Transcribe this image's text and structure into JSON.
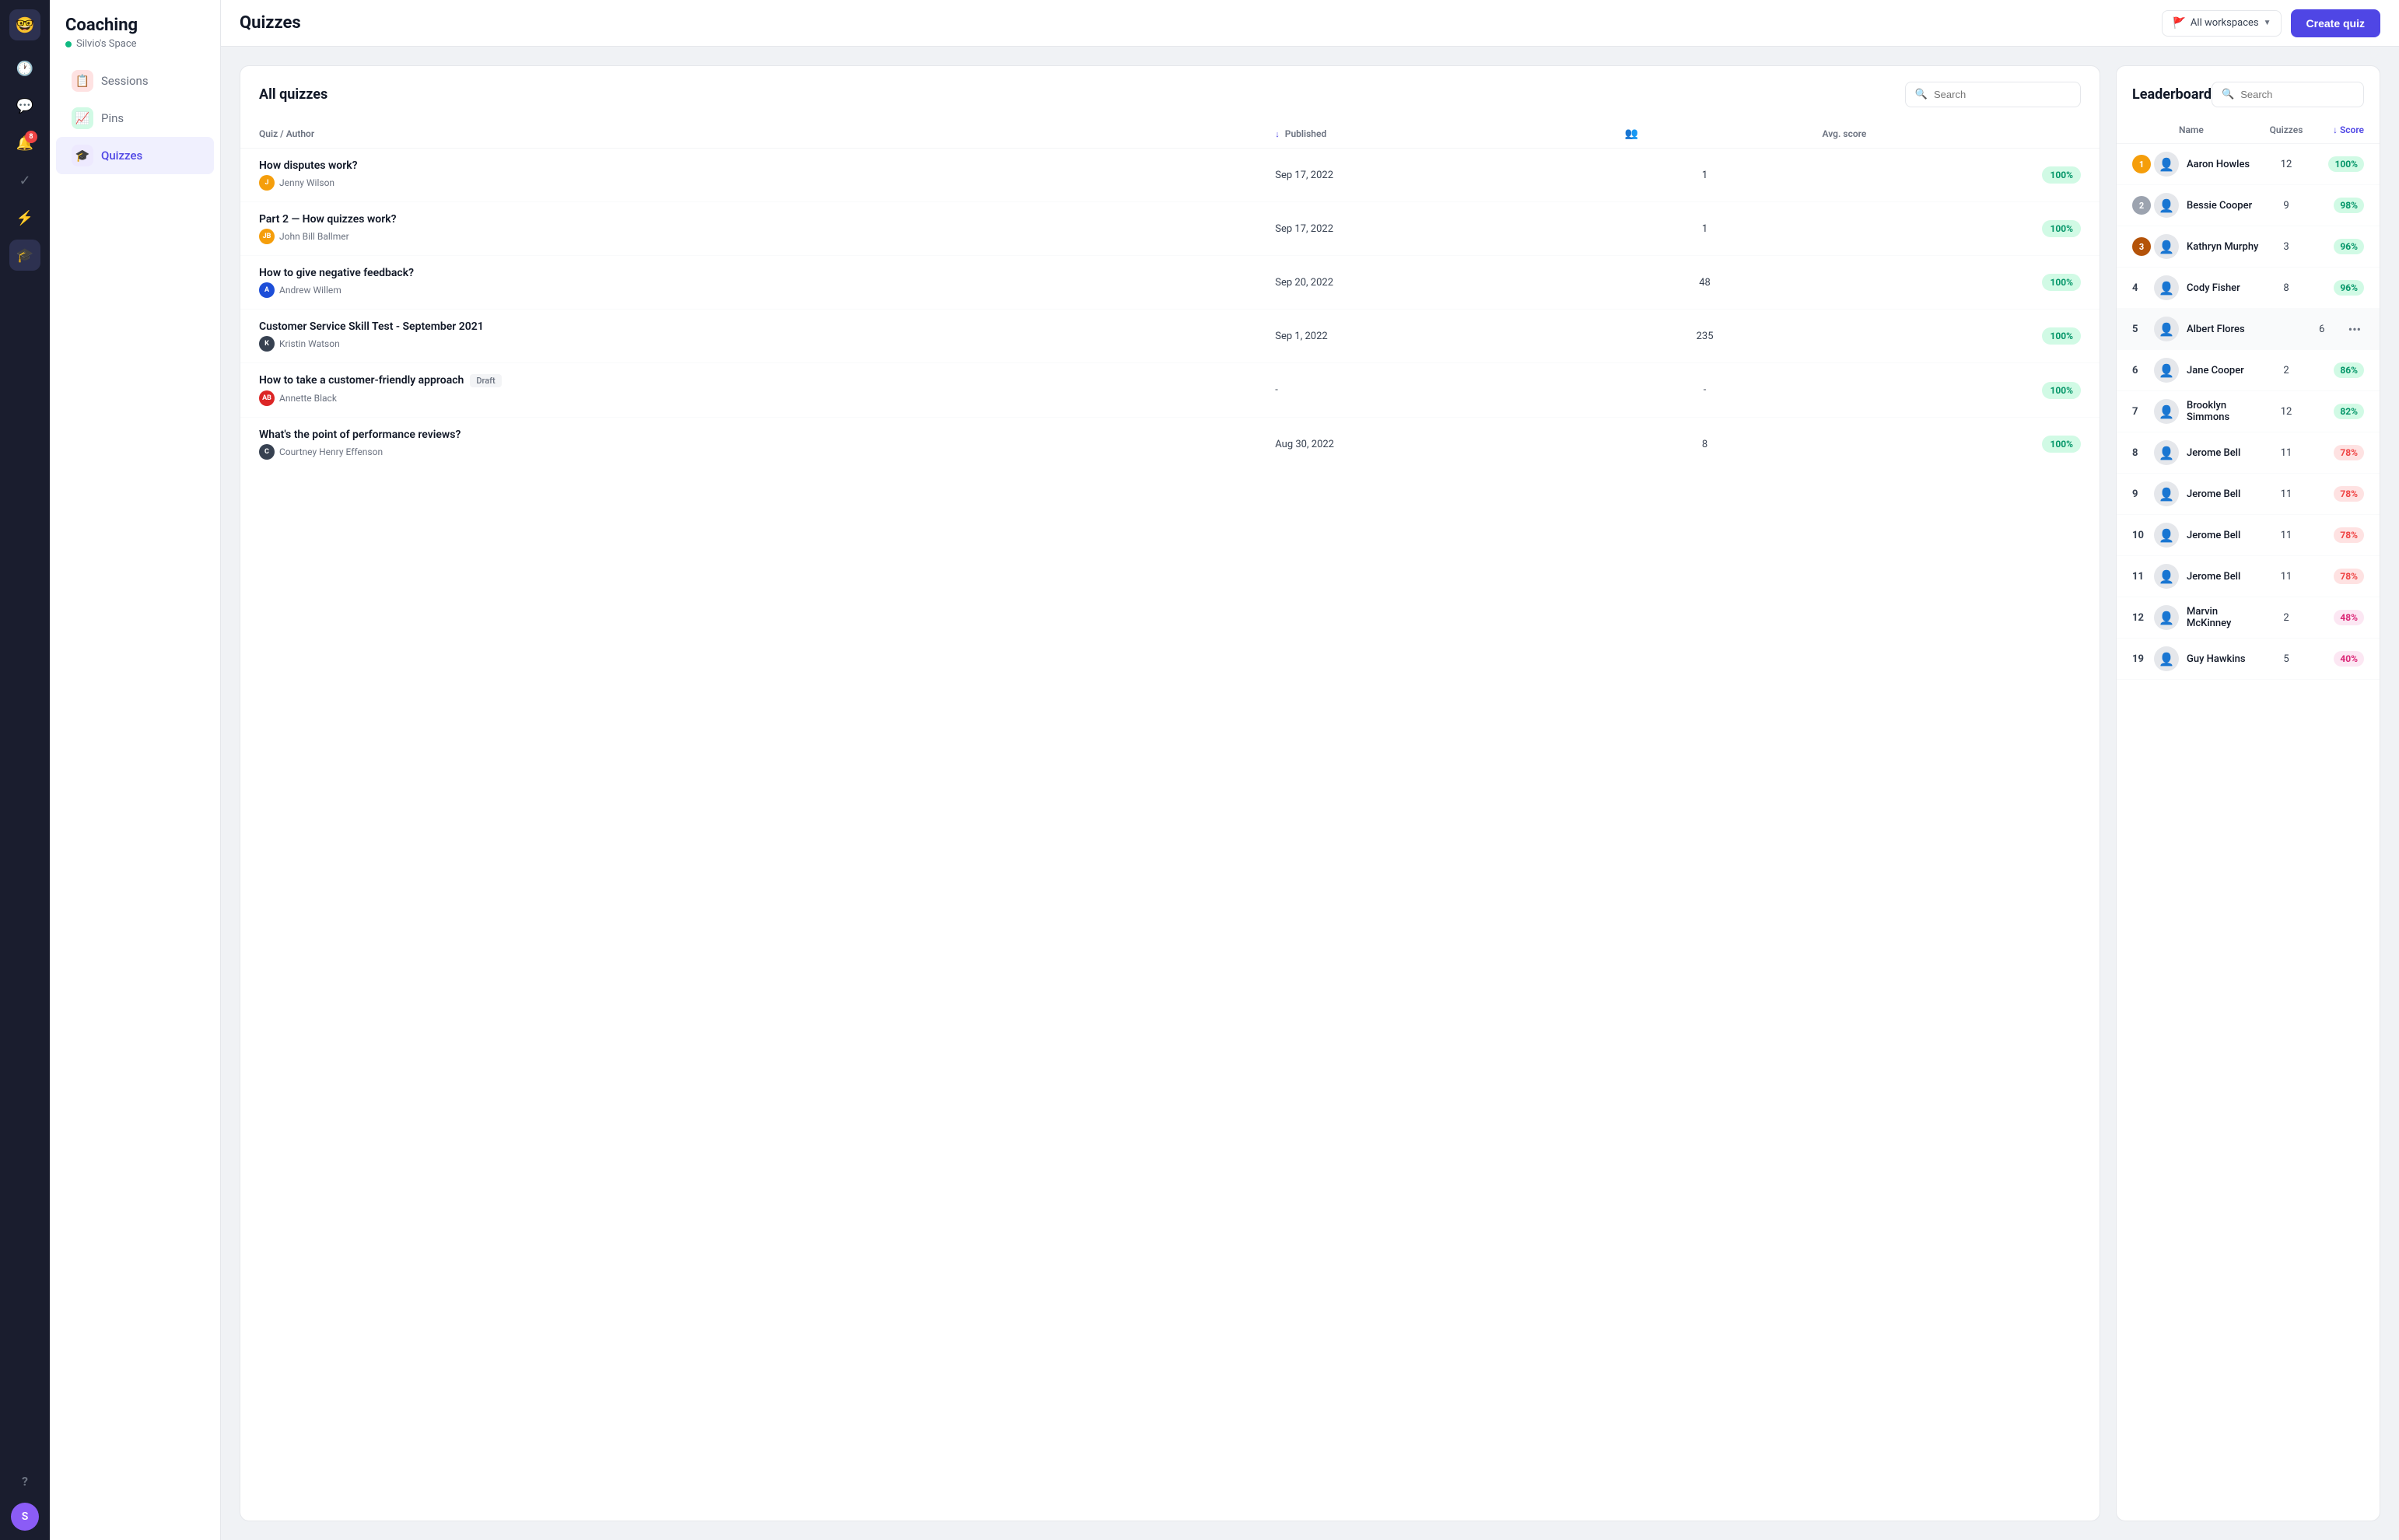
{
  "app": {
    "logo": "🤓",
    "title": "Coaching",
    "workspace": "Silvio's Space"
  },
  "darkSidebar": {
    "icons": [
      {
        "name": "clock-icon",
        "symbol": "🕐",
        "active": false
      },
      {
        "name": "chat-icon",
        "symbol": "💬",
        "active": false
      },
      {
        "name": "bell-icon",
        "symbol": "🔔",
        "active": false,
        "badge": "8"
      },
      {
        "name": "check-icon",
        "symbol": "✓",
        "active": false
      },
      {
        "name": "lightning-icon",
        "symbol": "⚡",
        "active": false
      },
      {
        "name": "graduation-icon",
        "symbol": "🎓",
        "active": true
      }
    ],
    "bottomIcons": [
      {
        "name": "help-icon",
        "symbol": "?"
      },
      {
        "name": "user-avatar",
        "initials": "S"
      }
    ]
  },
  "leftNav": {
    "items": [
      {
        "name": "sessions",
        "label": "Sessions",
        "icon": "📋",
        "iconClass": "sessions-icon",
        "active": false
      },
      {
        "name": "pins",
        "label": "Pins",
        "icon": "📈",
        "iconClass": "pins-icon",
        "active": false
      },
      {
        "name": "quizzes",
        "label": "Quizzes",
        "icon": "🎓",
        "iconClass": "quizzes-icon",
        "active": true
      }
    ]
  },
  "header": {
    "title": "Quizzes",
    "workspaceSelectorLabel": "All workspaces",
    "createButtonLabel": "Create quiz"
  },
  "quizzesPanel": {
    "title": "All quizzes",
    "searchPlaceholder": "Search",
    "columns": {
      "quizAuthor": "Quiz / Author",
      "published": "Published",
      "participants": "",
      "avgScore": "Avg. score"
    },
    "rows": [
      {
        "id": 1,
        "title": "How disputes work?",
        "author": "Jenny Wilson",
        "authorAvatar": "J",
        "authorColor": "#f59e0b",
        "published": "Sep 17, 2022",
        "participants": "1",
        "avgScore": "100%",
        "draft": false
      },
      {
        "id": 2,
        "title": "Part 2 — How quizzes work?",
        "author": "John Bill Ballmer",
        "authorAvatar": "JB",
        "authorColor": "#f59e0b",
        "published": "Sep 17, 2022",
        "participants": "1",
        "avgScore": "100%",
        "draft": false
      },
      {
        "id": 3,
        "title": "How to give negative feedback?",
        "author": "Andrew Willem",
        "authorAvatar": "A",
        "authorColor": "#1d4ed8",
        "published": "Sep 20, 2022",
        "participants": "48",
        "avgScore": "100%",
        "draft": false
      },
      {
        "id": 4,
        "title": "Customer Service Skill Test - September 2021",
        "author": "Kristin Watson",
        "authorAvatar": "K",
        "authorColor": "#374151",
        "published": "Sep 1, 2022",
        "participants": "235",
        "avgScore": "100%",
        "draft": false
      },
      {
        "id": 5,
        "title": "How to take a customer-friendly approach",
        "author": "Annette Black",
        "authorAvatar": "AB",
        "authorColor": "#dc2626",
        "published": "-",
        "participants": "-",
        "avgScore": "100%",
        "draft": true
      },
      {
        "id": 6,
        "title": "What's the point of performance reviews?",
        "author": "Courtney Henry Effenson",
        "authorAvatar": "C",
        "authorColor": "#374151",
        "published": "Aug 30, 2022",
        "participants": "8",
        "avgScore": "100%",
        "draft": false
      }
    ]
  },
  "leaderboard": {
    "title": "Leaderboard",
    "searchPlaceholder": "Search",
    "columns": {
      "name": "Name",
      "quizzes": "Quizzes",
      "score": "Score"
    },
    "rows": [
      {
        "rank": 1,
        "badgeType": "gold",
        "name": "Aaron Howles",
        "quizzes": 12,
        "score": "100%",
        "scoreClass": "score-green"
      },
      {
        "rank": 2,
        "badgeType": "silver",
        "name": "Bessie Cooper",
        "quizzes": 9,
        "score": "98%",
        "scoreClass": "score-green"
      },
      {
        "rank": 3,
        "badgeType": "bronze",
        "name": "Kathryn Murphy",
        "quizzes": 3,
        "score": "96%",
        "scoreClass": "score-green"
      },
      {
        "rank": 4,
        "badgeType": "plain",
        "name": "Cody Fisher",
        "quizzes": 8,
        "score": "96%",
        "scoreClass": "score-green"
      },
      {
        "rank": 5,
        "badgeType": "plain",
        "name": "Albert Flores",
        "quizzes": 6,
        "score": "",
        "scoreClass": "score-green",
        "highlighted": true,
        "showDots": true
      },
      {
        "rank": 6,
        "badgeType": "plain",
        "name": "Jane Cooper",
        "quizzes": 2,
        "score": "86%",
        "scoreClass": "score-green"
      },
      {
        "rank": 7,
        "badgeType": "plain",
        "name": "Brooklyn Simmons",
        "quizzes": 12,
        "score": "82%",
        "scoreClass": "score-green"
      },
      {
        "rank": 8,
        "badgeType": "plain",
        "name": "Jerome Bell",
        "quizzes": 11,
        "score": "78%",
        "scoreClass": "score-red"
      },
      {
        "rank": 9,
        "badgeType": "plain",
        "name": "Jerome Bell",
        "quizzes": 11,
        "score": "78%",
        "scoreClass": "score-red"
      },
      {
        "rank": 10,
        "badgeType": "plain",
        "name": "Jerome Bell",
        "quizzes": 11,
        "score": "78%",
        "scoreClass": "score-red"
      },
      {
        "rank": 11,
        "badgeType": "plain",
        "name": "Jerome Bell",
        "quizzes": 11,
        "score": "78%",
        "scoreClass": "score-red"
      },
      {
        "rank": 12,
        "badgeType": "plain",
        "name": "Marvin McKinney",
        "quizzes": 2,
        "score": "48%",
        "scoreClass": "score-pink"
      },
      {
        "rank": 19,
        "badgeType": "plain",
        "name": "Guy Hawkins",
        "quizzes": 5,
        "score": "40%",
        "scoreClass": "score-pink"
      }
    ]
  }
}
